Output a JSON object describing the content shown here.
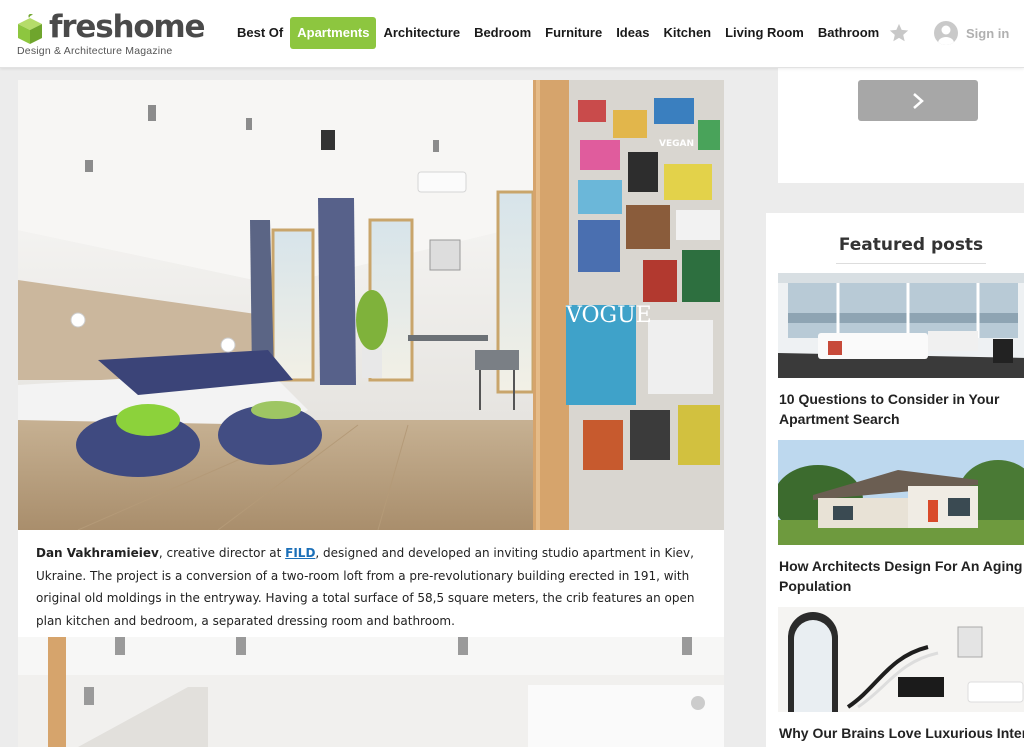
{
  "brand": {
    "name": "freshome",
    "tagline": "Design & Architecture Magazine",
    "accent": "#8dc63f"
  },
  "nav": {
    "items": [
      "Best Of",
      "Apartments",
      "Architecture",
      "Bedroom",
      "Furniture",
      "Ideas",
      "Kitchen",
      "Living Room",
      "Bathroom"
    ],
    "active": "Apartments",
    "signin_label": "Sign in"
  },
  "article": {
    "caption": {
      "author": "Dan Vakhramieiev",
      "text_before_link": ", creative director at ",
      "link_text": "FILD",
      "text_after_link": ", designed and developed an inviting studio apartment in Kiev, Ukraine. The project is a conversion of a two-room loft from a pre-revolutionary building erected in 191, with original old moldings in the entryway. Having a total surface of 58,5 square meters, the crib features an open plan kitchen and bedroom, a separated dressing room and bathroom."
    },
    "magazine_cover_text": "VOGUE",
    "poster_text": "VEGAN"
  },
  "sidebar": {
    "featured_title": "Featured posts",
    "posts": [
      {
        "title_line1": "10 Questions to Consider in Your",
        "title_line2": "Apartment Search"
      },
      {
        "title_line1": "How Architects Design For An Aging",
        "title_line2": "Population"
      },
      {
        "title_line1": "Why Our Brains Love Luxurious Interiors",
        "title_line2": ""
      }
    ]
  }
}
